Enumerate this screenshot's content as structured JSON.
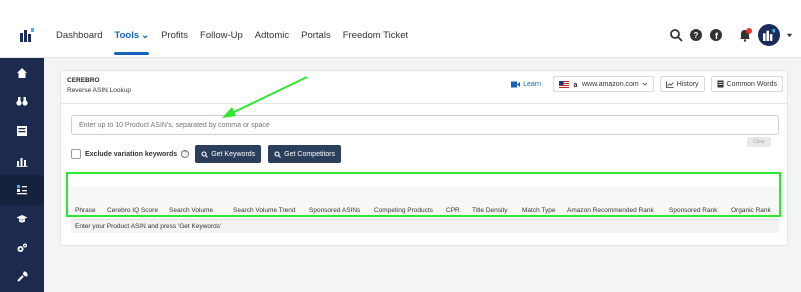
{
  "topnav": {
    "items": [
      {
        "label": "Dashboard"
      },
      {
        "label": "Tools",
        "active": true
      },
      {
        "label": "Profits"
      },
      {
        "label": "Follow-Up"
      },
      {
        "label": "Adtomic"
      },
      {
        "label": "Portals"
      },
      {
        "label": "Freedom Ticket"
      }
    ],
    "tools_chevron": "⌄"
  },
  "card": {
    "title": "CEREBRO",
    "subtitle": "Reverse ASIN Lookup",
    "learn_label": "Learn",
    "marketplace": "www.amazon.com",
    "history_label": "History",
    "common_words_label": "Common Words"
  },
  "search": {
    "placeholder": "Enter up to 10 Product ASIN's, separated by comma or space",
    "clear_label": "Clear"
  },
  "options": {
    "exclude_label": "Exclude variation keywords",
    "get_keywords_label": "Get Keywords",
    "get_competitors_label": "Get Competitors"
  },
  "table": {
    "headers": [
      "Phrase",
      "Cerebro IQ Score",
      "Search Volume",
      "Search Volume Trend",
      "Sponsored ASINs",
      "Competing Products",
      "CPR",
      "Title Density",
      "Match Type",
      "Amazon Recommended Rank",
      "Sponsored Rank",
      "Organic Rank"
    ],
    "empty_message": "Enter your Product ASIN and press 'Get Keywords'"
  },
  "colors": {
    "accent": "#1565c0",
    "sidebar": "#1c2a4d",
    "button_dark": "#2b3f5c",
    "highlight_green": "#2ee82e"
  }
}
